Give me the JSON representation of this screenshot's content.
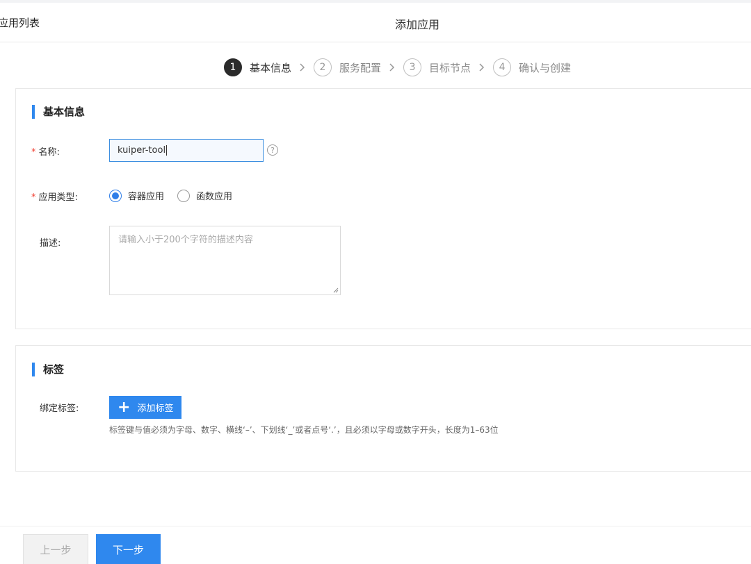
{
  "header": {
    "back_label": "应用列表",
    "title": "添加应用"
  },
  "steps": [
    {
      "number": "1",
      "label": "基本信息",
      "active": true
    },
    {
      "number": "2",
      "label": "服务配置",
      "active": false
    },
    {
      "number": "3",
      "label": "目标节点",
      "active": false
    },
    {
      "number": "4",
      "label": "确认与创建",
      "active": false
    }
  ],
  "basic_info": {
    "section_title": "基本信息",
    "name_label": "名称:",
    "name_value": "kuiper-tool",
    "help_icon": "?",
    "app_type_label": "应用类型:",
    "app_type_options": [
      {
        "label": "容器应用",
        "checked": true
      },
      {
        "label": "函数应用",
        "checked": false
      }
    ],
    "description_label": "描述:",
    "description_placeholder": "请输入小于200个字符的描述内容",
    "required_mark": "*"
  },
  "tags": {
    "section_title": "标签",
    "bind_label": "绑定标签:",
    "add_button_label": "添加标签",
    "hint": "标签键与值必须为字母、数字、横线‘–’、下划线‘_’或者点号‘.’，且必须以字母或数字开头，长度为1–63位"
  },
  "footer": {
    "prev_label": "上一步",
    "next_label": "下一步"
  },
  "colors": {
    "primary": "#2f88ee",
    "required": "#f04134",
    "active_step": "#2b2b2b"
  }
}
